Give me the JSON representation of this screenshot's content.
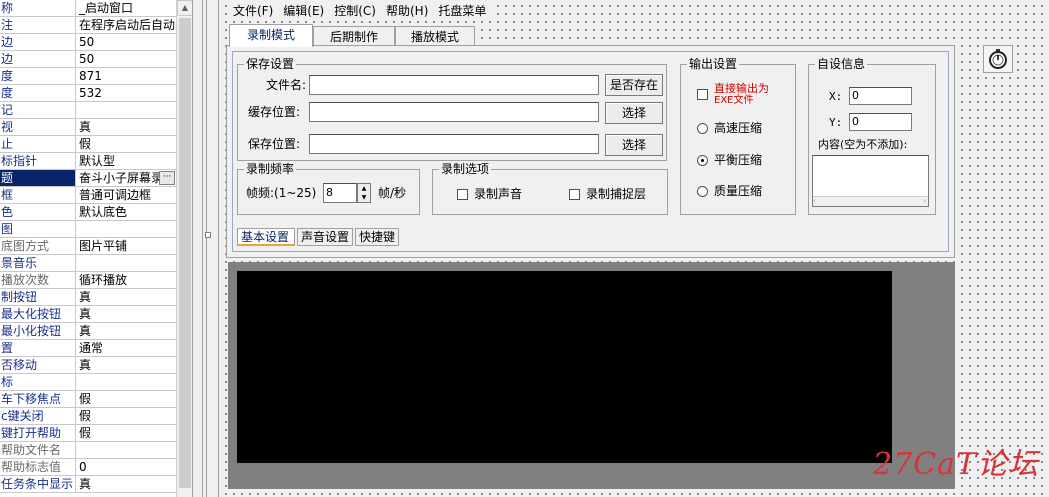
{
  "properties": [
    {
      "name": "称",
      "value": "_启动窗口",
      "style": "blue"
    },
    {
      "name": "注",
      "value": "在程序启动后自动",
      "style": "blue"
    },
    {
      "name": "边",
      "value": "50",
      "style": "blue"
    },
    {
      "name": "边",
      "value": "50",
      "style": "blue"
    },
    {
      "name": "度",
      "value": "871",
      "style": "blue"
    },
    {
      "name": "度",
      "value": "532",
      "style": "blue"
    },
    {
      "name": "记",
      "value": "",
      "style": "blue"
    },
    {
      "name": "视",
      "value": "真",
      "style": "blue"
    },
    {
      "name": "止",
      "value": "假",
      "style": "blue"
    },
    {
      "name": "标指针",
      "value": "默认型",
      "style": "blue"
    },
    {
      "name": "题",
      "value": "奋斗小子屏幕录",
      "style": "sel"
    },
    {
      "name": "框",
      "value": "普通可调边框",
      "style": "blue"
    },
    {
      "name": "色",
      "value": "默认底色",
      "style": "blue"
    },
    {
      "name": "图",
      "value": "",
      "style": "blue"
    },
    {
      "name": "底图方式",
      "value": "图片平铺",
      "style": "gray"
    },
    {
      "name": "景音乐",
      "value": "",
      "style": "blue"
    },
    {
      "name": "播放次数",
      "value": "循环播放",
      "style": "gray"
    },
    {
      "name": "制按钮",
      "value": "真",
      "style": "blue"
    },
    {
      "name": "最大化按钮",
      "value": "真",
      "style": "blue"
    },
    {
      "name": "最小化按钮",
      "value": "真",
      "style": "blue"
    },
    {
      "name": "置",
      "value": "通常",
      "style": "blue"
    },
    {
      "name": "否移动",
      "value": "真",
      "style": "blue"
    },
    {
      "name": "标",
      "value": "",
      "style": "blue"
    },
    {
      "name": "车下移焦点",
      "value": "假",
      "style": "blue"
    },
    {
      "name": "c键关闭",
      "value": "假",
      "style": "blue"
    },
    {
      "name": "键打开帮助",
      "value": "假",
      "style": "blue"
    },
    {
      "name": "帮助文件名",
      "value": "",
      "style": "gray"
    },
    {
      "name": "帮助标志值",
      "value": "0",
      "style": "gray"
    },
    {
      "name": "任务条中显示",
      "value": "真",
      "style": "blue"
    }
  ],
  "menu": [
    "文件(F)",
    "编辑(E)",
    "控制(C)",
    "帮助(H)",
    "托盘菜单"
  ],
  "tabs": [
    "录制模式",
    "后期制作",
    "播放模式"
  ],
  "save": {
    "legend": "保存设置",
    "filename_label": "文件名:",
    "cache_label": "缓存位置:",
    "save_label": "保存位置:",
    "exists_btn": "是否存在",
    "choose_btn": "选择",
    "choose_btn2": "选择"
  },
  "freq": {
    "legend": "录制频率",
    "label": "帧频:(1~25)",
    "value": "8",
    "unit": "帧/秒"
  },
  "rec_opts": {
    "legend": "录制选项",
    "sound": "录制声音",
    "layer": "录制捕捉层"
  },
  "output": {
    "legend": "输出设置",
    "exe_line1": "直接输出为",
    "exe_line2": "EXE文件",
    "high": "高速压缩",
    "balance": "平衡压缩",
    "quality": "质量压缩"
  },
  "custom": {
    "legend": "自设信息",
    "x_label": "X:",
    "x_value": "0",
    "y_label": "Y:",
    "y_value": "0",
    "content_label": "内容(空为不添加):"
  },
  "subtabs": [
    "基本设置",
    "声音设置",
    "快捷键"
  ],
  "watermark": "27CaT论坛",
  "colors": {
    "selection": "#0a246a",
    "exe_text": "#cc0000",
    "watermark": "#d8323a"
  }
}
